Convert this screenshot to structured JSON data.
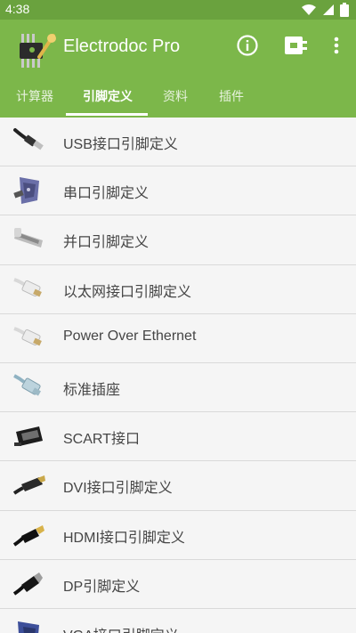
{
  "status": {
    "time": "4:38"
  },
  "app": {
    "title": "Electrodoc Pro"
  },
  "actions": {
    "info_icon": "info-icon",
    "plugin_icon": "plugin-icon",
    "more_icon": "more-vert-icon"
  },
  "tabs": [
    {
      "label": "计算器"
    },
    {
      "label": "引脚定义",
      "active": true
    },
    {
      "label": "资料"
    },
    {
      "label": "插件"
    }
  ],
  "items": [
    {
      "label": "USB接口引脚定义",
      "icon": "usb-cable-icon"
    },
    {
      "label": "串口引脚定义",
      "icon": "serial-connector-icon"
    },
    {
      "label": "并口引脚定义",
      "icon": "parallel-connector-icon"
    },
    {
      "label": "以太网接口引脚定义",
      "icon": "ethernet-plug-icon"
    },
    {
      "label": "Power Over Ethernet",
      "icon": "ethernet-plug-icon"
    },
    {
      "label": "标准插座",
      "icon": "phone-plug-icon"
    },
    {
      "label": "SCART接口",
      "icon": "scart-plug-icon"
    },
    {
      "label": "DVI接口引脚定义",
      "icon": "dvi-plug-icon"
    },
    {
      "label": "HDMI接口引脚定义",
      "icon": "hdmi-plug-icon"
    },
    {
      "label": "DP引脚定义",
      "icon": "displayport-plug-icon"
    },
    {
      "label": "VGA接口引脚定义",
      "icon": "vga-connector-icon"
    }
  ],
  "colors": {
    "status_bar": "#6aa23e",
    "app_bar": "#7cb74a",
    "list_bg": "#f5f5f5",
    "divider": "#d9d9d9"
  }
}
